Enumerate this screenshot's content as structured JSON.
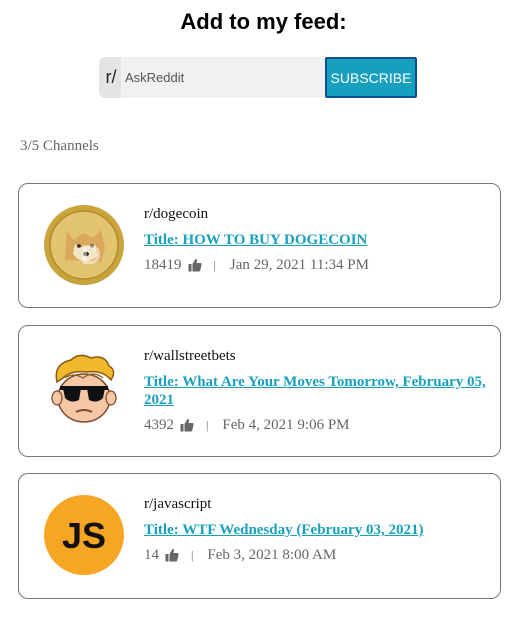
{
  "header": {
    "title": "Add to my feed:"
  },
  "subscribe": {
    "prefix": "r/",
    "placeholder": "AskReddit",
    "button_label": "SUBSCRIBE"
  },
  "channel_count": "3/5 Channels",
  "channels": [
    {
      "subreddit": "r/dogecoin",
      "title": "Title: HOW TO BUY DOGECOIN",
      "votes": "18419",
      "separator": "|",
      "date": "Jan 29, 2021 11:34 PM",
      "icon": "dogecoin-logo"
    },
    {
      "subreddit": "r/wallstreetbets",
      "title": "Title: What Are Your Moves Tomorrow, February 05, 2021",
      "votes": "4392",
      "separator": "|",
      "date": "Feb 4, 2021 9:06 PM",
      "icon": "wallstreetbets-logo"
    },
    {
      "subreddit": "r/javascript",
      "title": "Title: WTF Wednesday (February 03, 2021)",
      "votes": "14",
      "separator": "|",
      "date": "Feb 3, 2021 8:00 AM",
      "icon": "javascript-logo",
      "logo_text": "JS"
    }
  ],
  "colors": {
    "accent": "#16a0bf",
    "button_border": "#0b4f8f",
    "link": "#1aa0bf",
    "js_yellow": "#f6a623"
  }
}
